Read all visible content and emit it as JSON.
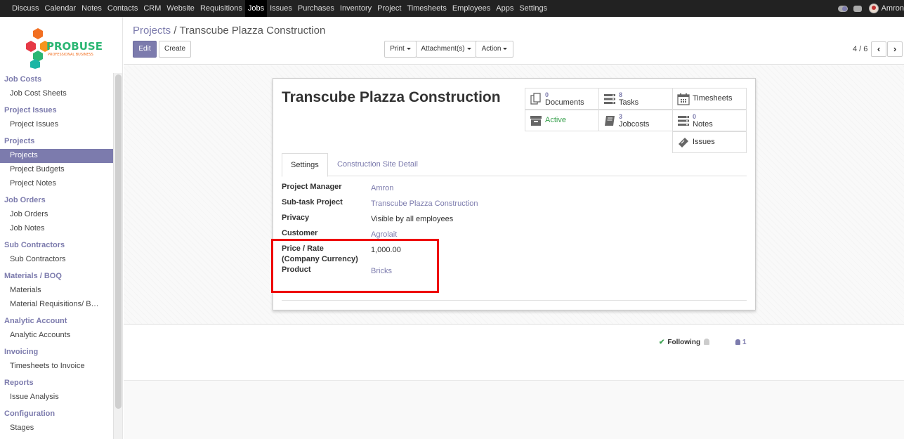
{
  "topbar": {
    "menu": [
      "Discuss",
      "Calendar",
      "Notes",
      "Contacts",
      "CRM",
      "Website",
      "Requisitions",
      "Jobs",
      "Issues",
      "Purchases",
      "Inventory",
      "Project",
      "Timesheets",
      "Employees",
      "Apps",
      "Settings"
    ],
    "active_menu": "Jobs",
    "user": "Amron"
  },
  "logo": {
    "name": "PROBUSE",
    "tagline": "PROFESSIONAL BUSINESS"
  },
  "sidebar": {
    "sections": [
      {
        "title": "Job Costs",
        "items": [
          "Job Cost Sheets"
        ]
      },
      {
        "title": "Project Issues",
        "items": [
          "Project Issues"
        ]
      },
      {
        "title": "Projects",
        "items": [
          "Projects",
          "Project Budgets",
          "Project Notes"
        ]
      },
      {
        "title": "Job Orders",
        "items": [
          "Job Orders",
          "Job Notes"
        ]
      },
      {
        "title": "Sub Contractors",
        "items": [
          "Sub Contractors"
        ]
      },
      {
        "title": "Materials / BOQ",
        "items": [
          "Materials",
          "Material Requisitions/ B…"
        ]
      },
      {
        "title": "Analytic Account",
        "items": [
          "Analytic Accounts"
        ]
      },
      {
        "title": "Invoicing",
        "items": [
          "Timesheets to Invoice"
        ]
      },
      {
        "title": "Reports",
        "items": [
          "Issue Analysis"
        ]
      },
      {
        "title": "Configuration",
        "items": [
          "Stages"
        ]
      }
    ],
    "active_item": "Projects"
  },
  "breadcrumb": {
    "parent": "Projects",
    "separator": "/",
    "current": "Transcube Plazza Construction"
  },
  "buttons": {
    "edit": "Edit",
    "create": "Create",
    "print": "Print",
    "attachments": "Attachment(s)",
    "action": "Action"
  },
  "pager": {
    "value": "4 / 6",
    "prev": "‹",
    "next": "›"
  },
  "record": {
    "title": "Transcube Plazza Construction",
    "smart_buttons": {
      "documents": {
        "count": "0",
        "label": "Documents"
      },
      "tasks": {
        "count": "8",
        "label": "Tasks"
      },
      "timesheets": {
        "label": "Timesheets"
      },
      "active": {
        "label": "Active"
      },
      "jobcosts": {
        "count": "3",
        "label": "Jobcosts"
      },
      "notes": {
        "count": "0",
        "label": "Notes"
      },
      "issues": {
        "label": "Issues"
      }
    },
    "tabs": [
      "Settings",
      "Construction Site Detail"
    ],
    "fields": {
      "project_manager": {
        "label": "Project Manager",
        "value": "Amron"
      },
      "subtask_project": {
        "label": "Sub-task Project",
        "value": "Transcube Plazza Construction"
      },
      "privacy": {
        "label": "Privacy",
        "value": "Visible by all employees"
      },
      "customer": {
        "label": "Customer",
        "value": "Agrolait"
      },
      "price_rate": {
        "label_line1": "Price / Rate",
        "label_line2": "(Company Currency)",
        "value": "1,000.00"
      },
      "product": {
        "label": "Product",
        "value": "Bricks"
      }
    }
  },
  "chatter": {
    "following": "Following",
    "followers": "1"
  },
  "colors": {
    "accent": "#7c7bad",
    "topbar": "#222222",
    "active_green": "#3ba250",
    "highlight": "#ee0000"
  }
}
